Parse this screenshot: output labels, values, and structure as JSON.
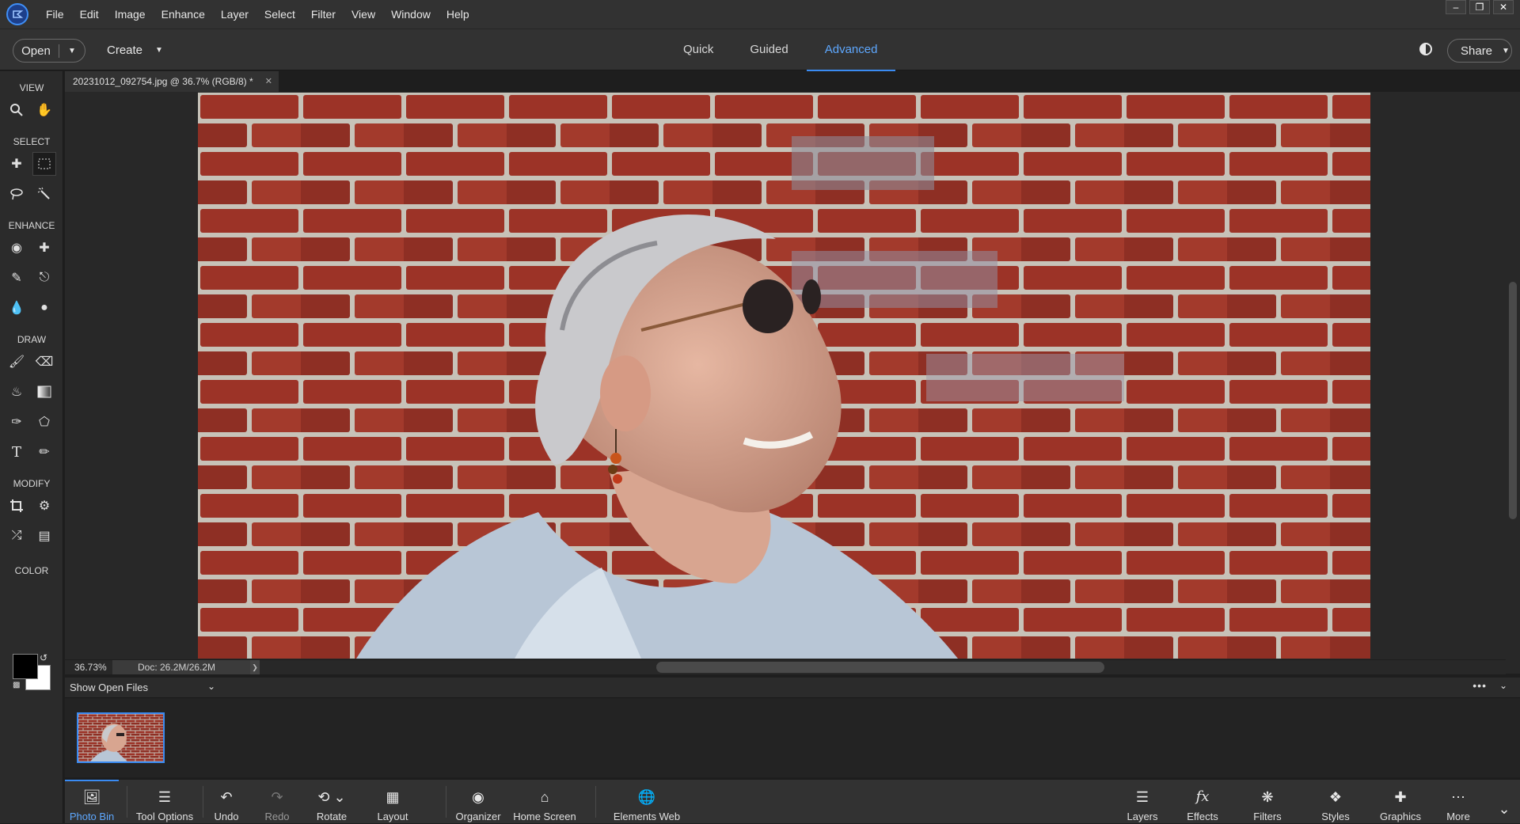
{
  "menubar": {
    "items": [
      "File",
      "Edit",
      "Image",
      "Enhance",
      "Layer",
      "Select",
      "Filter",
      "View",
      "Window",
      "Help"
    ],
    "window_controls": [
      "minimize-icon",
      "restore-icon",
      "close-icon"
    ]
  },
  "toolbar": {
    "open_label": "Open",
    "create_label": "Create",
    "mode_tabs": [
      "Quick",
      "Guided",
      "Advanced"
    ],
    "active_mode": "Advanced",
    "share_label": "Share"
  },
  "toolbox": {
    "sections": {
      "view": "VIEW",
      "select": "SELECT",
      "enhance": "ENHANCE",
      "draw": "DRAW",
      "modify": "MODIFY",
      "color": "COLOR"
    },
    "foreground_color": "#000000",
    "background_color": "#ffffff"
  },
  "document": {
    "tab_title": "20231012_092754.jpg @ 36.7% (RGB/8) *",
    "zoom": "36.73%",
    "doc_size": "Doc: 26.2M/26.2M"
  },
  "photo_bin": {
    "header_label": "Show Open Files"
  },
  "taskbar": {
    "left": [
      {
        "label": "Photo Bin",
        "icon": "photo-bin-icon"
      },
      {
        "label": "Tool Options",
        "icon": "tool-options-icon"
      },
      {
        "label": "Undo",
        "icon": "undo-icon"
      },
      {
        "label": "Redo",
        "icon": "redo-icon"
      },
      {
        "label": "Rotate",
        "icon": "rotate-icon"
      },
      {
        "label": "Layout",
        "icon": "layout-icon"
      },
      {
        "label": "Organizer",
        "icon": "organizer-icon"
      },
      {
        "label": "Home Screen",
        "icon": "home-icon"
      },
      {
        "label": "Elements Web",
        "icon": "globe-icon"
      }
    ],
    "right": [
      {
        "label": "Layers",
        "icon": "layers-icon"
      },
      {
        "label": "Effects",
        "icon": "fx-icon"
      },
      {
        "label": "Filters",
        "icon": "filters-icon"
      },
      {
        "label": "Styles",
        "icon": "styles-icon"
      },
      {
        "label": "Graphics",
        "icon": "plus-icon"
      },
      {
        "label": "More",
        "icon": "more-icon"
      }
    ]
  },
  "colors": {
    "accent": "#3a8bf2",
    "panel": "#323232",
    "background": "#1e1e1e"
  }
}
